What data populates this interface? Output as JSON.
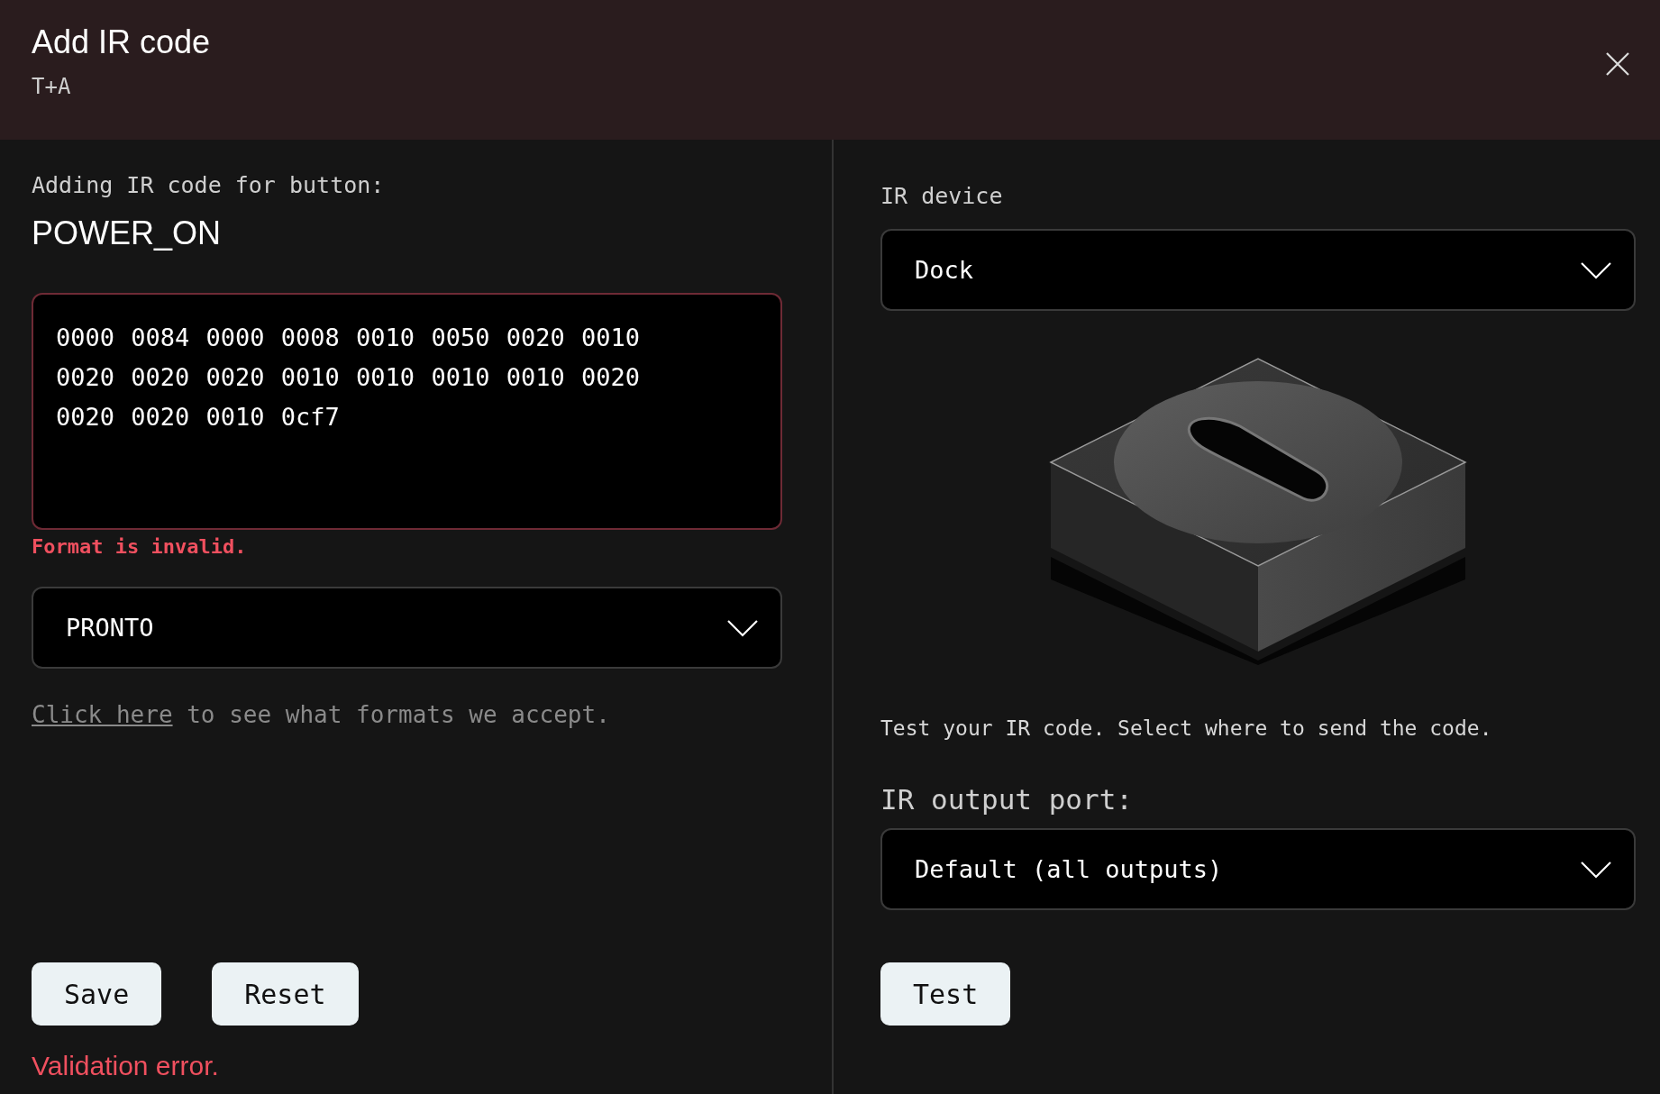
{
  "dialog": {
    "title": "Add IR code",
    "subtitle": "T+A"
  },
  "left": {
    "prompt": "Adding IR code for button:",
    "button_name": "POWER_ON",
    "code": "0000 0084 0000 0008 0010 0050 0020 0010 0020 0020 0020 0010 0010 0010 0010 0020 0020 0020 0010 0cf7",
    "code_error": "Format is invalid.",
    "format": "PRONTO",
    "help": {
      "link": "Click here",
      "text": " to see what formats we accept."
    },
    "buttons": [
      "Save",
      "Reset"
    ],
    "validation_error": "Validation error."
  },
  "right": {
    "device_label": "IR device",
    "device": "Dock",
    "test_hint": "Test your IR code. Select where to send the code.",
    "port_label": "IR output port:",
    "port": "Default (all outputs)",
    "test_button": "Test"
  }
}
